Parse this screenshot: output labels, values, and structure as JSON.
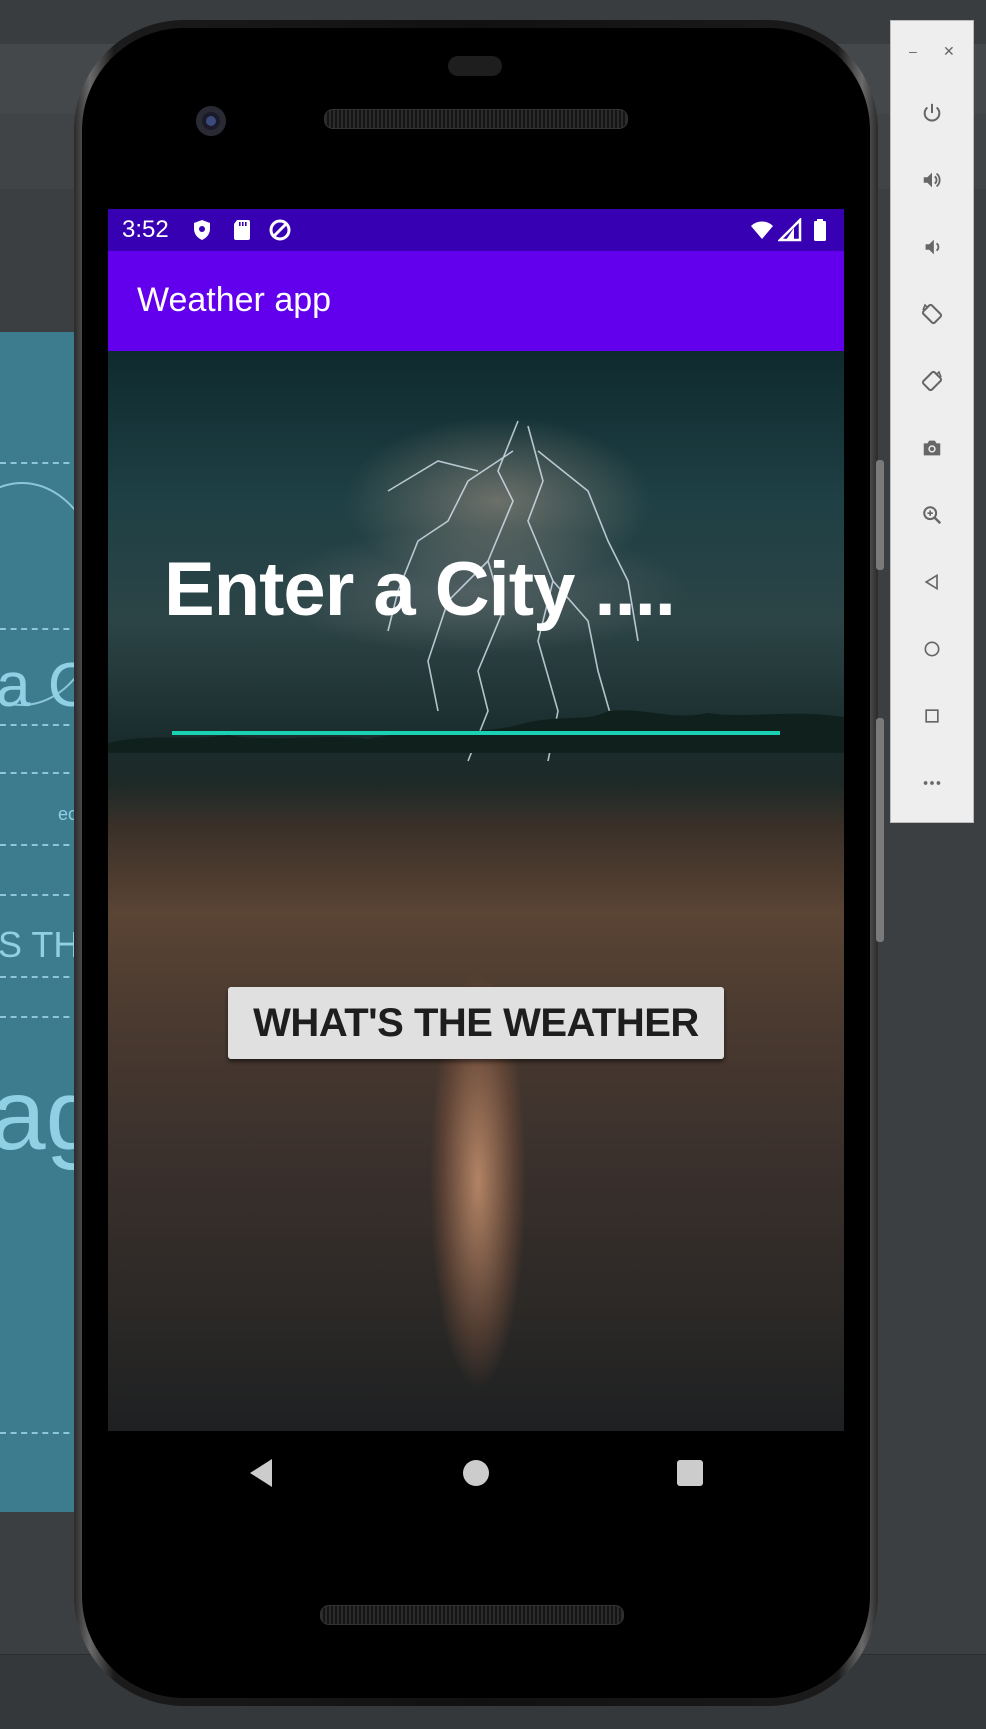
{
  "status_bar": {
    "time": "3:52"
  },
  "app": {
    "title": "Weather app",
    "heading": "Enter a City ....",
    "city_input": {
      "value": "",
      "placeholder": ""
    },
    "button_label": "WHAT'S THE WEATHER"
  },
  "colors": {
    "status_bar": "#3700b3",
    "app_bar": "#6200ee",
    "input_underline": "#1ad1b4",
    "button_bg": "#e0e0e0"
  },
  "blueprint_preview": {
    "heading_fragment": "a C",
    "input_fragment": "ec",
    "button_fragment": "S TH",
    "image_fragment": "age"
  },
  "emulator_toolbar": {
    "window_controls": [
      "minimize",
      "close"
    ],
    "items": [
      "power-icon",
      "volume-up-icon",
      "volume-down-icon",
      "rotate-left-icon",
      "rotate-right-icon",
      "camera-icon",
      "zoom-icon",
      "back-icon",
      "home-icon",
      "overview-icon",
      "more-icon"
    ]
  }
}
